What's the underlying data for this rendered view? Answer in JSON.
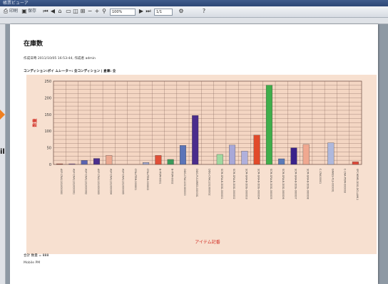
{
  "window": {
    "title": "帳票ビューア"
  },
  "toolbar": {
    "print_label": "印刷",
    "save_label": "保存",
    "zoom_value": "100%",
    "page_value": "1/1"
  },
  "report": {
    "title": "在庫数",
    "meta": "作成日時 2011/10/05 16:53:44, 作成者 admin",
    "condition": "コンディション:ポイ ムレーター: 全コンディション | 倉庫: 全",
    "total": "合計 数量 = 888",
    "footnote": "Mobile PM"
  },
  "chart_data": {
    "type": "bar",
    "xlabel": "アイテム記番",
    "ylabel": "数量",
    "ylim": [
      0,
      250
    ],
    "yticks": [
      0,
      50,
      100,
      150,
      200,
      250
    ],
    "grid": true,
    "categories": [
      "ASP-CRA1101000000",
      "ASP-CRA1101000001",
      "ASP-CRA1101000002",
      "ASP-CRA1101000003",
      "ASP-CRA1101000004",
      "ASP-CRA1101000005",
      "CRA-ITEM-000001",
      "CRA-ITEM-000002",
      "B-ITEM-0001",
      "B-ITEM-0002",
      "DOG-CRA1101000000",
      "DOG-PLS-BRED-000001",
      "DOG-CRA1101000002",
      "SCM-GRA-B-DOG-000001",
      "SCM-GRA-B-DOG-000002",
      "SCM-GRA-B-DOG-000003",
      "SCM-GRA-B-DOG-000004",
      "SCM-GRA-B-DOG-000005",
      "SCM-GRA-B-DOG-000006",
      "SCM-GRA-B-DOG-000007",
      "SCM-GRA-B-DOG-000008",
      "C-CRA00001",
      "GRASS-PLS-000001",
      "C-CRA-ITEM-000003",
      "SPCHEMS-DOG-OCLLAM-1"
    ],
    "values": [
      2,
      2,
      12,
      18,
      27,
      0,
      0,
      6,
      27,
      15,
      57,
      147,
      0,
      30,
      58,
      40,
      88,
      238,
      17,
      50,
      60,
      0,
      65,
      0,
      8
    ],
    "colors": [
      "#c44a3a",
      "#8e5aa6",
      "#5b64b0",
      "#4b2f8e",
      "#eca890",
      "#cccccc",
      "#a1a4c8",
      "#a1a4c8",
      "#e14f37",
      "#3a9a5a",
      "#5b74b8",
      "#4a2c8c",
      "#cccccc",
      "#9fd89f",
      "#a8a8d8",
      "#b0b0dc",
      "#e14a2a",
      "#3fae4a",
      "#5b7ab8",
      "#3a228a",
      "#f0a890",
      "#cccccc",
      "#aeb8dd",
      "#cccccc",
      "#e14a3a"
    ]
  }
}
